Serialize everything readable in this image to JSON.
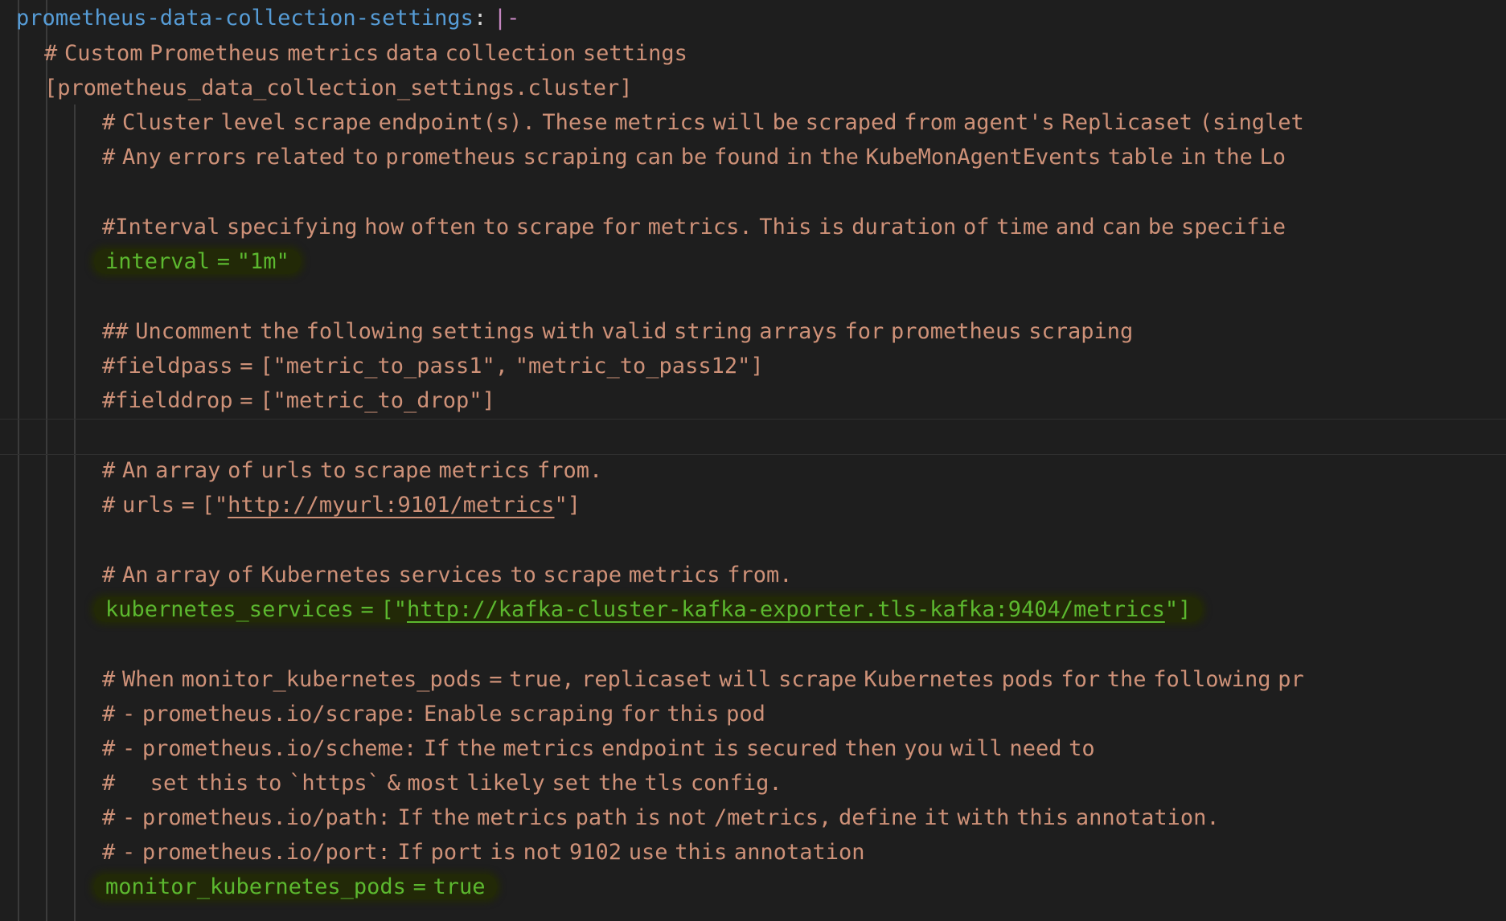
{
  "editor": {
    "lines": {
      "l1": {
        "key": "prometheus-data-collection-settings",
        "colon": ":",
        "indicator": "|-"
      },
      "l2": "# Custom Prometheus metrics data collection settings",
      "l3": "[prometheus_data_collection_settings.cluster]",
      "l4": "# Cluster level scrape endpoint(s). These metrics will be scraped from agent's Replicaset (singlet",
      "l5": "# Any errors related to prometheus scraping can be found in the KubeMonAgentEvents table in the Lo",
      "l6": "#Interval specifying how often to scrape for metrics. This is duration of time and can be specifie",
      "l7": "interval = \"1m\"",
      "l8": "## Uncomment the following settings with valid string arrays for prometheus scraping",
      "l9": "#fieldpass = [\"metric_to_pass1\", \"metric_to_pass12\"]",
      "l10": "#fielddrop = [\"metric_to_drop\"]",
      "l11": "# An array of urls to scrape metrics from.",
      "l12": {
        "pre": "# urls = [\"",
        "link": "http://myurl:9101/metrics",
        "post": "\"]"
      },
      "l13": "# An array of Kubernetes services to scrape metrics from.",
      "l14": {
        "pre": "kubernetes_services = [\"",
        "link": "http://kafka-cluster-kafka-exporter.tls-kafka:9404/metrics",
        "post": "\"]"
      },
      "l15": "# When monitor_kubernetes_pods = true, replicaset will scrape Kubernetes pods for the following pr",
      "l16": "# - prometheus.io/scrape: Enable scraping for this pod",
      "l17": "# - prometheus.io/scheme: If the metrics endpoint is secured then you will need to",
      "l18": "#     set this to `https` & most likely set the tls config.",
      "l19": "# - prometheus.io/path: If the metrics path is not /metrics, define it with this annotation.",
      "l20": "# - prometheus.io/port: If port is not 9102 use this annotation",
      "l21": "monitor_kubernetes_pods = true"
    },
    "colors": {
      "background": "#1e1e1e",
      "key": "#569cd6",
      "string_comment": "#ce9178",
      "highlighted_setting": "#5cb82f",
      "marker_highlight": "#232a05"
    }
  }
}
